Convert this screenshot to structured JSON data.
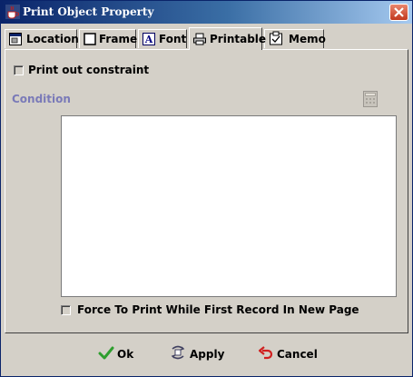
{
  "window": {
    "title": "Print Object Property"
  },
  "tabs": [
    {
      "label": "Location",
      "icon": "location-icon"
    },
    {
      "label": "Frame",
      "icon": "frame-icon"
    },
    {
      "label": "Font",
      "icon": "font-icon"
    },
    {
      "label": "Printable",
      "icon": "printer-icon",
      "selected": true
    },
    {
      "label": "Memo",
      "icon": "clipboard-icon"
    }
  ],
  "printable": {
    "print_out_constraint_label": "Print out constraint",
    "print_out_constraint_checked": false,
    "condition_label": "Condition",
    "condition_value": "",
    "force_print_label": "Force To Print While First Record In New Page",
    "force_print_checked": false
  },
  "buttons": {
    "ok_label": "Ok",
    "apply_label": "Apply",
    "cancel_label": "Cancel"
  },
  "colors": {
    "title_start": "#0a246a",
    "title_end": "#a6caf0",
    "dialog_bg": "#d4d0c8",
    "condition_label": "#7a7ab8",
    "close_button": "#c2391f",
    "ok_icon": "#2e9e2e",
    "cancel_icon": "#d02020"
  }
}
